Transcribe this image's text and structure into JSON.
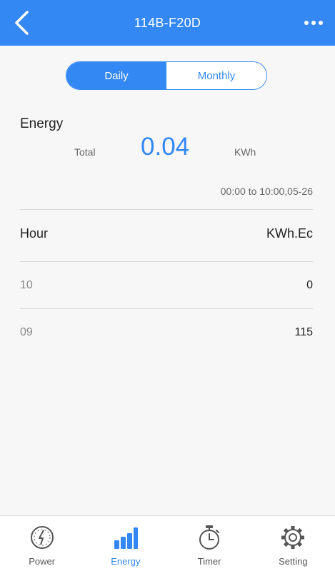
{
  "header": {
    "title": "114B-F20D",
    "back_icon": "chevron-left-icon",
    "more_icon": "more-horizontal-icon"
  },
  "segment": {
    "daily_label": "Daily",
    "monthly_label": "Monthly",
    "selected": "Daily"
  },
  "energy": {
    "title": "Energy",
    "total_label": "Total",
    "total_value": "0.04",
    "unit": "KWh",
    "range": "00:00 to 10:00,05-26"
  },
  "table": {
    "col_hour": "Hour",
    "col_value": "KWh.Ec",
    "rows": [
      {
        "hour": "10",
        "value": "0"
      },
      {
        "hour": "09",
        "value": "115"
      }
    ]
  },
  "tabs": [
    {
      "label": "Power",
      "icon": "power-gauge-icon"
    },
    {
      "label": "Energy",
      "icon": "bar-chart-icon"
    },
    {
      "label": "Timer",
      "icon": "stopwatch-icon"
    },
    {
      "label": "Setting",
      "icon": "gear-icon"
    }
  ],
  "colors": {
    "accent": "#3388f4",
    "background": "#f7f7f7",
    "tab_inactive": "#555555"
  }
}
